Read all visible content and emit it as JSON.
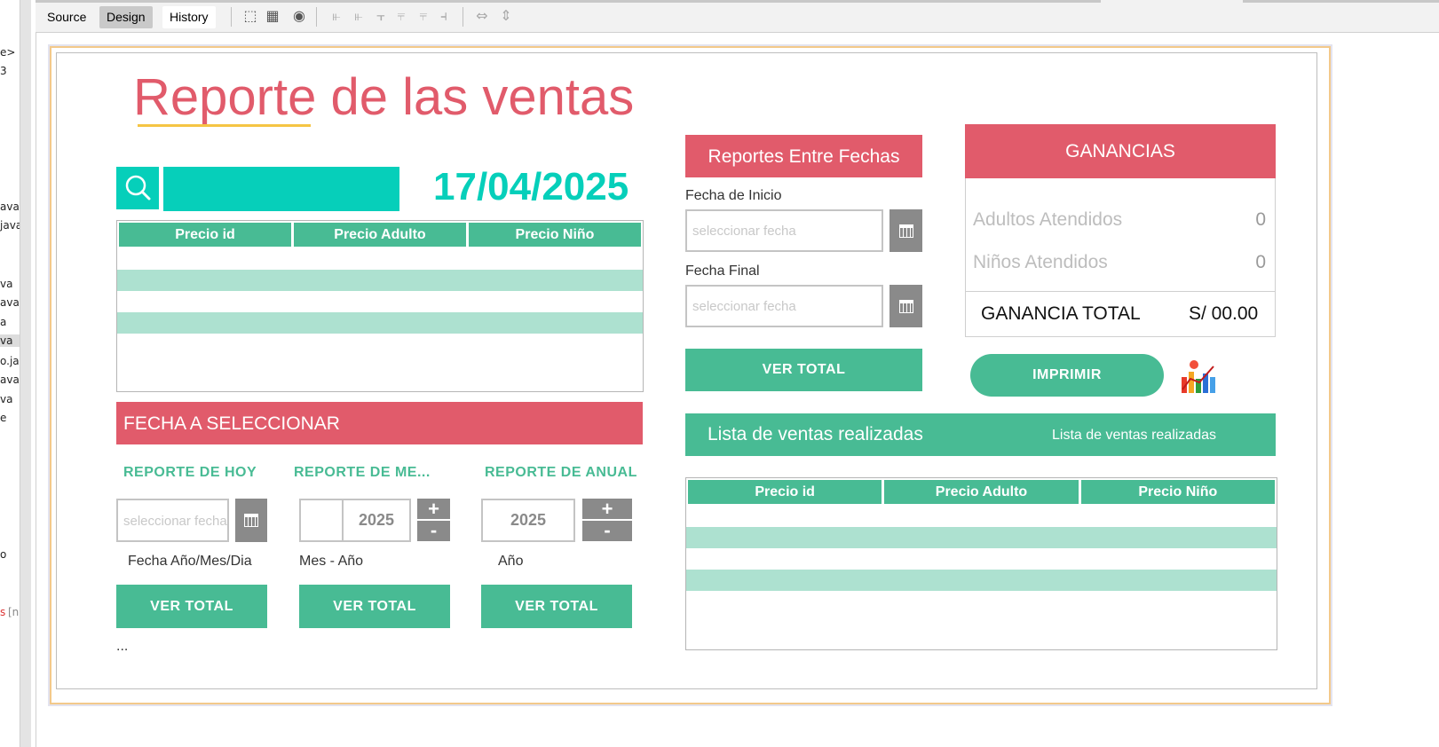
{
  "ide": {
    "tabs": [
      "Source",
      "Design",
      "History"
    ],
    "active_tab": "Design",
    "left_fragments": [
      "e>",
      "3",
      "ava",
      "java",
      "va",
      "ava",
      "a",
      "va",
      "o.ja",
      "ava",
      "va",
      "e",
      "o",
      "s",
      "[n"
    ]
  },
  "form": {
    "title": "Reporte de las ventas",
    "search": {
      "value": ""
    },
    "date_display": "17/04/2025",
    "top_table": {
      "headers": [
        "Precio id",
        "Precio Adulto",
        "Precio Niño"
      ]
    },
    "fecha_bar": "FECHA  A SELECCIONAR",
    "report_hoy": {
      "label": "REPORTE DE HOY",
      "placeholder": "seleccionar fecha",
      "caption": "Fecha Año/Mes/Dia",
      "button": "VER TOTAL"
    },
    "report_mes": {
      "label": "REPORTE DE ME...",
      "month_value": "",
      "year_value": "2025",
      "plus": "+",
      "minus": "-",
      "caption": "Mes  - Año",
      "button": "VER TOTAL"
    },
    "report_anual": {
      "label": "REPORTE DE ANUAL",
      "year_value": "2025",
      "plus": "+",
      "minus": "-",
      "caption": "Año",
      "button": "VER TOTAL"
    },
    "ellipsis": "...",
    "between_dates": {
      "header": "Reportes Entre Fechas",
      "start_label": "Fecha de Inicio",
      "start_placeholder": "seleccionar fecha",
      "end_label": "Fecha Final",
      "end_placeholder": "seleccionar fecha",
      "button": "VER TOTAL"
    },
    "ganancias": {
      "header": "GANANCIAS",
      "adultos_label": "Adultos Atendidos",
      "adultos_value": "0",
      "ninos_label": "Niños Atendidos",
      "ninos_value": "0",
      "total_label": "GANANCIA TOTAL",
      "total_value": "S/ 00.00"
    },
    "print_button": "IMPRIMIR",
    "sales_list": {
      "title": "Lista de ventas realizadas",
      "subtitle": "Lista de ventas realizadas",
      "headers": [
        "Precio id",
        "Precio Adulto",
        "Precio Niño"
      ]
    }
  },
  "colors": {
    "accent_red": "#e15b6b",
    "accent_green": "#48bb94",
    "accent_teal": "#06cfba",
    "stripe": "#ade1d0"
  }
}
